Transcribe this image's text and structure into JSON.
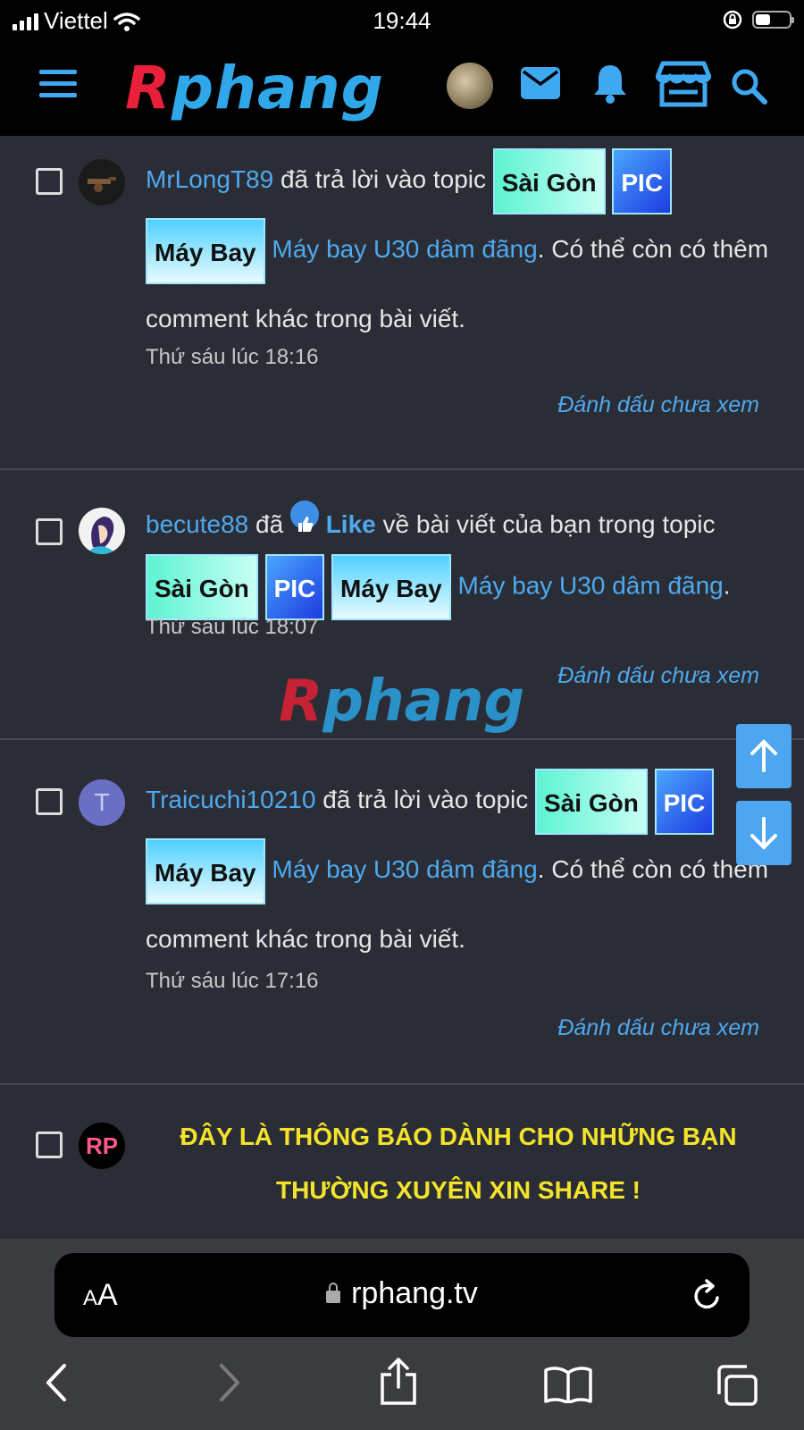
{
  "status_bar": {
    "carrier": "Viettel",
    "time": "19:44",
    "battery_level": 0.45
  },
  "header": {
    "logo_first": "R",
    "logo_rest": "phang"
  },
  "feed": [
    {
      "user": "MrLongT89",
      "action": " đã trả lời vào topic ",
      "tags": [
        "Sài Gòn",
        "PIC",
        "Máy Bay"
      ],
      "topic": "Máy bay U30 dâm đãng",
      "suffix": ". Có thể còn có thêm comment khác trong bài viết.",
      "time": "Thứ sáu lúc 18:16",
      "mark": "Đánh dấu chưa xem"
    },
    {
      "user": "becute88",
      "action_pre": " đã ",
      "like": "Like",
      "action_post": " về bài viết của bạn trong topic",
      "tags": [
        "Sài Gòn",
        "PIC",
        "Máy Bay"
      ],
      "topic": "Máy bay U30 dâm đãng",
      "suffix": ".",
      "time": "Thứ sáu lúc 18:07",
      "mark": "Đánh dấu chưa xem"
    },
    {
      "user": "Traicuchi10210",
      "avatar_letter": "T",
      "action": " đã trả lời vào topic ",
      "tags": [
        "Sài Gòn",
        "PIC",
        "Máy Bay"
      ],
      "topic": "Máy bay U30 dâm đãng",
      "suffix": ". Có thể còn có thêm comment khác trong bài viết.",
      "time": "Thứ sáu lúc 17:16",
      "mark": "Đánh dấu chưa xem"
    },
    {
      "avatar_letters": "RP",
      "notice_line1": "ĐÂY LÀ THÔNG BÁO DÀNH CHO NHỮNG BẠN",
      "notice_line2": "THƯỜNG XUYÊN XIN SHARE !"
    }
  ],
  "watermark": {
    "first": "R",
    "rest": "phang"
  },
  "browser": {
    "aa_small": "A",
    "aa_big": "A",
    "url": "rphang.tv"
  },
  "colors": {
    "accent": "#4fa9ef",
    "notice": "#f3e32a",
    "background": "#2a2d35"
  }
}
